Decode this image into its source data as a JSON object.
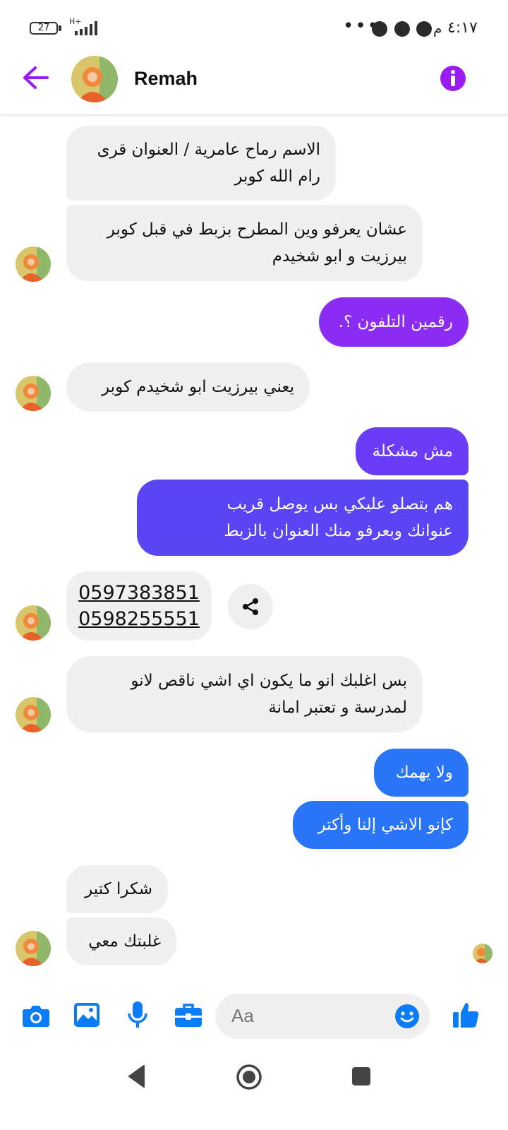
{
  "status_bar": {
    "battery": "27",
    "network": "H+",
    "time": "٤:١٧",
    "ampm": "م",
    "dots": "•••"
  },
  "header": {
    "contact_name": "Remah",
    "back_icon": "arrow-left-icon",
    "info_icon": "info-icon"
  },
  "colors": {
    "accent": "#9b1cf2",
    "incoming_bg": "#f0f0f0",
    "out_1": "#8b2cf5",
    "out_2_top": "#6a3cf7",
    "out_2_bottom": "#5a45f5",
    "out_3": "#2a74f8",
    "icon_blue": "#0a7cf7"
  },
  "messages": [
    {
      "dir": "in",
      "text": "الاسم رماح عامرية / العنوان قرى\nرام الله كوبر"
    },
    {
      "dir": "in",
      "text": "عشان يعرفو وين المطرح بزبط في قبل كوبر\nبيرزيت و ابو شخيدم"
    },
    {
      "dir": "out",
      "text": "رقمين التلفون ؟."
    },
    {
      "dir": "in",
      "text": "يعني بيرزيت ابو شخيدم كوبر"
    },
    {
      "dir": "out",
      "text": "مش مشكلة"
    },
    {
      "dir": "out",
      "text": "هم بتصلو عليكي بس يوصل قريب\nعنوانك وبعرفو منك العنوان بالزبط"
    },
    {
      "dir": "in",
      "text": "0597383851\n0598255551"
    },
    {
      "dir": "in",
      "text": "بس اغلبك انو ما يكون اي اشي ناقص لانو\nلمدرسة و تعتبر امانة"
    },
    {
      "dir": "out",
      "text": "ولا يهمك"
    },
    {
      "dir": "out",
      "text": "كإنو الاشي إلنا وأكتر"
    },
    {
      "dir": "in",
      "text": "شكرا كتير"
    },
    {
      "dir": "in",
      "text": "غلبتك معي"
    }
  ],
  "composer": {
    "placeholder": "Aa",
    "icons": [
      "camera-icon",
      "image-icon",
      "microphone-icon",
      "toolbox-icon",
      "emoji-icon",
      "thumbs-up-icon"
    ]
  },
  "nav_icons": [
    "back-triangle-icon",
    "home-circle-icon",
    "recents-square-icon"
  ]
}
